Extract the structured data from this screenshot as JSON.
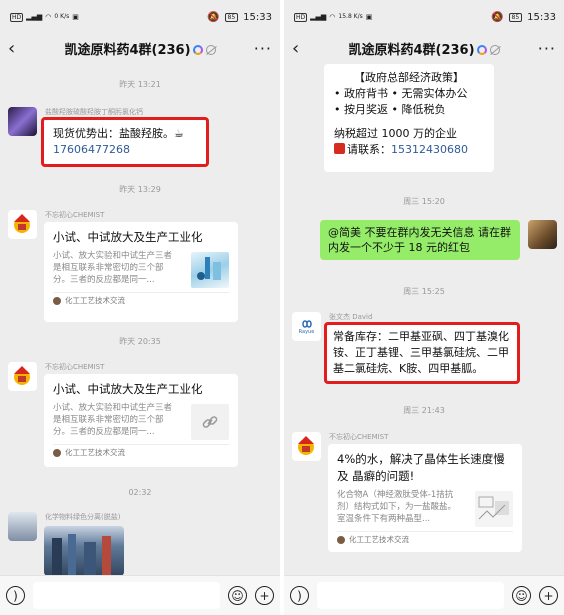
{
  "left": {
    "status": {
      "time": "15:33",
      "network": "0 K/s",
      "battery": "85"
    },
    "title": "凯途原料药4群(236)",
    "messages": {
      "t1": "昨天 13:21",
      "m1": {
        "sender": "盐酸羟胺硫酸羟胺丁酮肟氯化钙",
        "line1": "现货优势出：盐酸羟胺。☕",
        "line2": "17606477268"
      },
      "t2": "昨天 13:29",
      "m2": {
        "sender": "不忘初心CHEMIST",
        "card_title": "小试、中试放大及生产工业化",
        "card_desc": "小试、放大实验和中试生产三者是相互联系非常密切的三个部分。三者的反应都是同一...",
        "card_source": "化工工艺技术交流"
      },
      "t3": "昨天 20:35",
      "m3": {
        "sender": "不忘初心CHEMIST",
        "card_title": "小试、中试放大及生产工业化",
        "card_desc": "小试、放大实验和中试生产三者是相互联系非常密切的三个部分。三者的反应都是同一...",
        "card_source": "化工工艺技术交流"
      },
      "t4": "02:32",
      "m4": {
        "sender": "化学物料绿色分离(脱盐)"
      }
    }
  },
  "right": {
    "status": {
      "time": "15:33",
      "network": "15.8 K/s",
      "battery": "85"
    },
    "title": "凯途原料药4群(236)",
    "messages": {
      "m0": {
        "line1": "【政府总部经济政策】",
        "line2": "• 政府背书   • 无需实体办公",
        "line3": "• 按月奖返   • 降低税负",
        "line4": "纳税超过 1000 万的企业",
        "line5_prefix": "请联系：",
        "line5_num": "15312430680"
      },
      "t1": "周三 15:20",
      "m1": {
        "text": "@简美 不要在群内发无关信息 请在群内发一个不少于 18 元的红包"
      },
      "t2": "周三 15:25",
      "m2": {
        "sender": "张文杰 David",
        "avatar_text": "Rayue",
        "text": "常备库存：二甲基亚砜、四丁基溴化铵、正丁基锂、三甲基氯硅烷、二甲基二氯硅烷、K胺、四甲基胍。"
      },
      "t3": "周三 21:43",
      "m3": {
        "sender": "不忘初心CHEMIST",
        "card_title": "4%的水，解决了晶体生长速度慢及 晶癖的问题!",
        "card_desc": "化合物A（神经激肽受体-1拮抗剂）结构式如下，为一盐酸盐。室温条件下有两种晶型...",
        "card_source": "化工工艺技术交流"
      }
    }
  },
  "colors": {
    "highlight": "#e11d1d",
    "sent_bubble": "#95ec69",
    "link": "#2f5b97"
  }
}
